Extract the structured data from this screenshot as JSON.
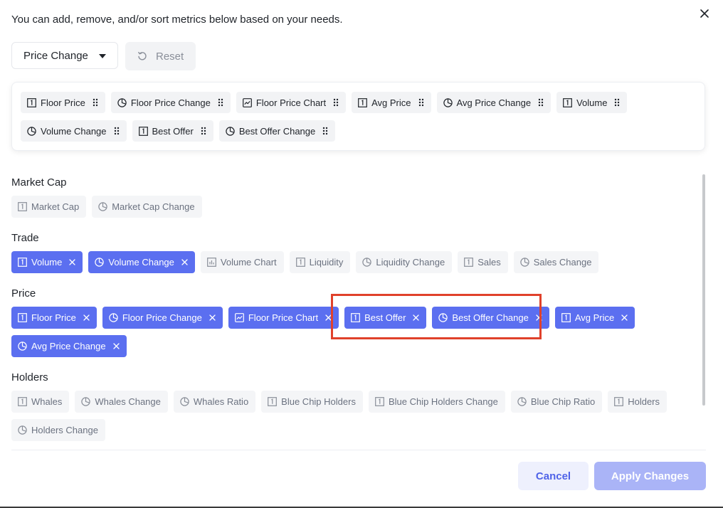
{
  "header": {
    "description": "You can add, remove, and/or sort metrics below based on your needs.",
    "close_icon": "close-icon"
  },
  "toolbar": {
    "preset_value": "Price Change",
    "reset_label": "Reset"
  },
  "selected_metrics": [
    {
      "label": "Floor Price",
      "icon": "number-icon"
    },
    {
      "label": "Floor Price Change",
      "icon": "pie-icon"
    },
    {
      "label": "Floor Price Chart",
      "icon": "chart-icon"
    },
    {
      "label": "Avg Price",
      "icon": "number-icon"
    },
    {
      "label": "Avg Price Change",
      "icon": "pie-icon"
    },
    {
      "label": "Volume",
      "icon": "number-icon"
    },
    {
      "label": "Volume Change",
      "icon": "pie-icon"
    },
    {
      "label": "Best Offer",
      "icon": "number-icon"
    },
    {
      "label": "Best Offer Change",
      "icon": "pie-icon"
    }
  ],
  "sections": [
    {
      "title": "Market Cap",
      "chips": [
        {
          "label": "Market Cap",
          "icon": "number-icon",
          "selected": false
        },
        {
          "label": "Market Cap Change",
          "icon": "pie-icon",
          "selected": false
        }
      ]
    },
    {
      "title": "Trade",
      "chips": [
        {
          "label": "Volume",
          "icon": "number-icon",
          "selected": true
        },
        {
          "label": "Volume Change",
          "icon": "pie-icon",
          "selected": true
        },
        {
          "label": "Volume Chart",
          "icon": "bar-chart-icon",
          "selected": false
        },
        {
          "label": "Liquidity",
          "icon": "number-icon",
          "selected": false
        },
        {
          "label": "Liquidity Change",
          "icon": "pie-icon",
          "selected": false
        },
        {
          "label": "Sales",
          "icon": "number-icon",
          "selected": false
        },
        {
          "label": "Sales Change",
          "icon": "pie-icon",
          "selected": false
        }
      ]
    },
    {
      "title": "Price",
      "chips": [
        {
          "label": "Floor Price",
          "icon": "number-icon",
          "selected": true
        },
        {
          "label": "Floor Price Change",
          "icon": "pie-icon",
          "selected": true
        },
        {
          "label": "Floor Price Chart",
          "icon": "chart-icon",
          "selected": true
        },
        {
          "label": "Best Offer",
          "icon": "number-icon",
          "selected": true
        },
        {
          "label": "Best Offer Change",
          "icon": "pie-icon",
          "selected": true
        },
        {
          "label": "Avg Price",
          "icon": "number-icon",
          "selected": true
        },
        {
          "label": "Avg Price Change",
          "icon": "pie-icon",
          "selected": true
        }
      ]
    },
    {
      "title": "Holders",
      "chips": [
        {
          "label": "Whales",
          "icon": "number-icon",
          "selected": false
        },
        {
          "label": "Whales Change",
          "icon": "pie-icon",
          "selected": false
        },
        {
          "label": "Whales Ratio",
          "icon": "pie-icon",
          "selected": false
        },
        {
          "label": "Blue Chip Holders",
          "icon": "number-icon",
          "selected": false
        },
        {
          "label": "Blue Chip Holders Change",
          "icon": "number-icon",
          "selected": false
        },
        {
          "label": "Blue Chip Ratio",
          "icon": "pie-icon",
          "selected": false
        },
        {
          "label": "Holders",
          "icon": "number-icon",
          "selected": false
        },
        {
          "label": "Holders Change",
          "icon": "pie-icon",
          "selected": false
        }
      ]
    }
  ],
  "footer": {
    "cancel_label": "Cancel",
    "apply_label": "Apply Changes"
  },
  "colors": {
    "accent": "#5b6ff0",
    "accent_light": "#aab4f7",
    "highlight": "#e0412b"
  }
}
